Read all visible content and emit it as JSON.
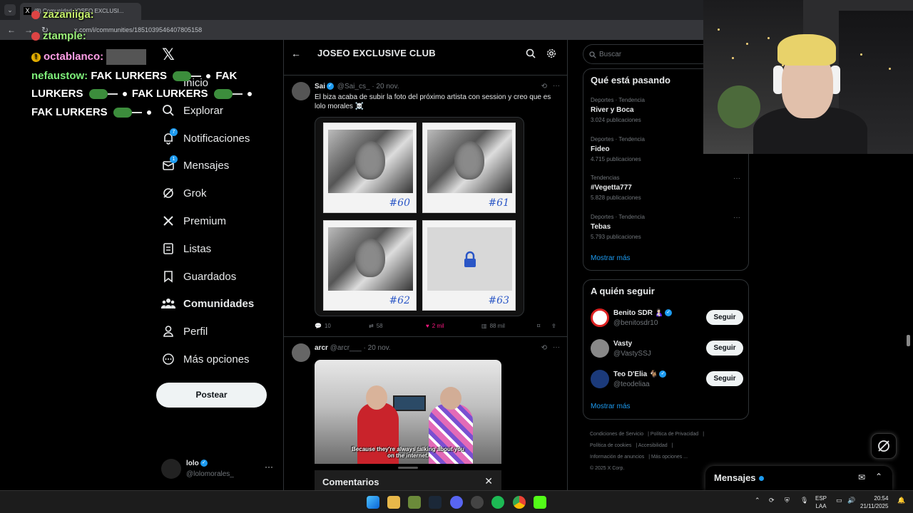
{
  "browser": {
    "tab_title": "(8) Comunidad JOSEO EXCLUSI...",
    "url": "x.com/i/communities/1851039546407805158"
  },
  "chat": {
    "line1_user": "zazaniiga:",
    "line2_user": "ztample:",
    "line3_user": "octablanco:",
    "line4_user": "nefaustow:",
    "line4_text": "FAK LURKERS",
    "line4_text2": "FAK",
    "line5_text": "LURKERS",
    "line5_text2": "FAK LURKERS",
    "line6_text": "FAK LURKERS"
  },
  "nav": {
    "items": [
      {
        "label": "Inicio",
        "icon": "home-icon"
      },
      {
        "label": "Explorar",
        "icon": "search-icon"
      },
      {
        "label": "Notificaciones",
        "icon": "bell-icon",
        "badge": "7"
      },
      {
        "label": "Mensajes",
        "icon": "mail-icon",
        "badge": "1"
      },
      {
        "label": "Grok",
        "icon": "grok-icon"
      },
      {
        "label": "Premium",
        "icon": "x-icon"
      },
      {
        "label": "Listas",
        "icon": "list-icon"
      },
      {
        "label": "Guardados",
        "icon": "bookmark-icon"
      },
      {
        "label": "Comunidades",
        "icon": "communities-icon"
      },
      {
        "label": "Perfil",
        "icon": "person-icon"
      },
      {
        "label": "Más opciones",
        "icon": "more-icon"
      }
    ],
    "post_label": "Postear",
    "profile_name": "lolo",
    "profile_handle": "@lolomorales_"
  },
  "community": {
    "title": "JOSEO EXCLUSIVE CLUB"
  },
  "tweet1": {
    "name": "Sai",
    "handle": "@Sai_cs_",
    "date": "· 20 nov.",
    "text": "El biza acaba de subir la foto del próximo artista con session y creo que es lolo morales ☠️",
    "photos": [
      "#60",
      "#61",
      "#62",
      "#63"
    ],
    "replies": "10",
    "reposts": "58",
    "likes": "2 mil",
    "views": "88 mil"
  },
  "tweet2": {
    "name": "arcr",
    "handle": "@arcr___",
    "date": "· 20 nov.",
    "caption_line1": "Because they're always talking about you",
    "caption_line2": "on the internet."
  },
  "comments": {
    "label": "Comentarios"
  },
  "right": {
    "search_placeholder": "Buscar",
    "trends_title": "Qué está pasando",
    "trends": [
      {
        "context": "Deportes · Tendencia",
        "title": "River y Boca",
        "count": "3.024 publicaciones"
      },
      {
        "context": "Deportes · Tendencia",
        "title": "Fideo",
        "count": "4.715 publicaciones"
      },
      {
        "context": "Tendencias",
        "title": "#Vegetta777",
        "count": "5.828 publicaciones"
      },
      {
        "context": "Deportes · Tendencia",
        "title": "Tebas",
        "count": "5.793 publicaciones"
      }
    ],
    "show_more": "Mostrar más",
    "follow_title": "A quién seguir",
    "follows": [
      {
        "name": "Benito SDR 🤱🏻",
        "handle": "@benitosdr10",
        "button": "Seguir"
      },
      {
        "name": "Vasty",
        "handle": "@VastySSJ",
        "button": "Seguir"
      },
      {
        "name": "Teo D'Elia 🐐",
        "handle": "@teodeliaa",
        "button": "Seguir"
      }
    ],
    "footer": [
      "Condiciones de Servicio",
      "Política de Privacidad",
      "Política de cookies",
      "Accesibilidad",
      "Información de anuncios",
      "Más opciones ...",
      "© 2025 X Corp."
    ],
    "messages_label": "Mensajes"
  },
  "taskbar": {
    "lang_top": "ESP",
    "lang_bottom": "LAA",
    "time": "20:54",
    "date": "21/11/2025"
  },
  "colors": {
    "accent": "#1d9bf0",
    "like": "#f91880",
    "background": "#000000",
    "border": "#2f3336"
  }
}
